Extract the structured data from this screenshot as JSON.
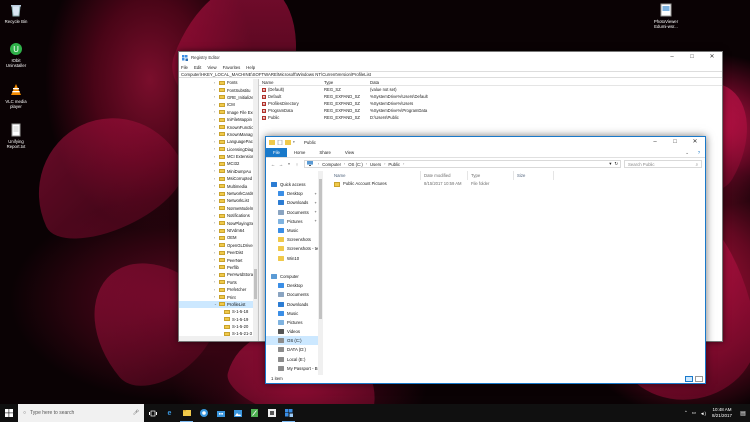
{
  "desktop_icons": [
    {
      "label": "Recycle Bin",
      "icon": "recycle-bin-icon"
    },
    {
      "label": "IObit Uninstaller",
      "icon": "iobit-uninstaller-icon"
    },
    {
      "label": "VLC media player",
      "icon": "vlc-icon"
    },
    {
      "label": "Unifying Report.txt",
      "icon": "text-file-icon"
    },
    {
      "label": "PhotoViewer Edumi-wsr...",
      "icon": "image-file-icon"
    }
  ],
  "regedit": {
    "title": "Registry Editor",
    "menu": [
      "File",
      "Edit",
      "View",
      "Favorites",
      "Help"
    ],
    "address": "Computer\\HKEY_LOCAL_MACHINE\\SOFTWARE\\Microsoft\\Windows NT\\CurrentVersion\\ProfileList",
    "tree": [
      "Fonts",
      "FontSubstitu",
      "GRE_Initialize",
      "ICM",
      "Image File Exe",
      "IniFileMappin",
      "KnownFunctio",
      "KnownManag",
      "LanguagePacl",
      "LicensingDiag",
      "MCI Extension",
      "MCI32",
      "MiniDumpAu",
      "MsiCorrupted",
      "Multimedia",
      "NetworkCards",
      "NetworkList",
      "NoImeModelm",
      "Notifications",
      "NowPlayingSe",
      "NtVdm64",
      "OEM",
      "OpenGLDriver",
      "PeerDist",
      "PeerNet",
      "Perflib",
      "PerHwIdStora",
      "Ports",
      "Prefetcher",
      "Print",
      "ProfileList"
    ],
    "subkeys": [
      "S-1-5-18",
      "S-1-5-19",
      "S-1-5-20",
      "S-1-5-21-3",
      "S-1-5-21-3"
    ],
    "tree_last": "ProfileNotifica",
    "columns": {
      "name": "Name",
      "type": "Type",
      "data": "Data"
    },
    "values": [
      {
        "name": "(Default)",
        "type": "REG_SZ",
        "data": "(value not set)"
      },
      {
        "name": "Default",
        "type": "REG_EXPAND_SZ",
        "data": "%SystemDrive%\\Users\\Default"
      },
      {
        "name": "ProfilesDirectory",
        "type": "REG_EXPAND_SZ",
        "data": "%SystemDrive%\\Users"
      },
      {
        "name": "ProgramData",
        "type": "REG_EXPAND_SZ",
        "data": "%SystemDrive%\\ProgramData"
      },
      {
        "name": "Public",
        "type": "REG_EXPAND_SZ",
        "data": "D:\\Users\\Public"
      }
    ]
  },
  "explorer": {
    "title": "Public",
    "ribbon_tabs": [
      "File",
      "Home",
      "Share",
      "View"
    ],
    "path": [
      "Computer",
      "OS (C:)",
      "Users",
      "Public"
    ],
    "search_placeholder": "Search Public",
    "nav": [
      {
        "label": "Quick access",
        "top": true,
        "color": "#2b7cd3",
        "pin": false
      },
      {
        "label": "Desktop",
        "top": false,
        "color": "#3a8ee6",
        "pin": true
      },
      {
        "label": "Downloads",
        "top": false,
        "color": "#2b7cd3",
        "pin": true
      },
      {
        "label": "Documents",
        "top": false,
        "color": "#8aa4c1",
        "pin": true
      },
      {
        "label": "Pictures",
        "top": false,
        "color": "#7fb3e0",
        "pin": true
      },
      {
        "label": "Music",
        "top": false,
        "color": "#3a8ee6",
        "pin": false
      },
      {
        "label": "Screenshots",
        "top": false,
        "color": "#f0c94a",
        "pin": false
      },
      {
        "label": "Screenshots - ten",
        "top": false,
        "color": "#f0c94a",
        "pin": false
      },
      {
        "label": "Win10",
        "top": false,
        "color": "#f0c94a",
        "pin": false
      },
      {
        "label": "",
        "top": false,
        "color": "transparent",
        "pin": false
      },
      {
        "label": "Computer",
        "top": true,
        "color": "#5b9bd5",
        "pin": false
      },
      {
        "label": "Desktop",
        "top": false,
        "color": "#3a8ee6",
        "pin": false
      },
      {
        "label": "Documents",
        "top": false,
        "color": "#8aa4c1",
        "pin": false
      },
      {
        "label": "Downloads",
        "top": false,
        "color": "#2b7cd3",
        "pin": false
      },
      {
        "label": "Music",
        "top": false,
        "color": "#3a8ee6",
        "pin": false
      },
      {
        "label": "Pictures",
        "top": false,
        "color": "#7fb3e0",
        "pin": false
      },
      {
        "label": "Videos",
        "top": false,
        "color": "#555555",
        "pin": false
      },
      {
        "label": "OS (C:)",
        "top": false,
        "color": "#8c8c8c",
        "pin": false,
        "selected": true
      },
      {
        "label": "DATA (D:)",
        "top": false,
        "color": "#8c8c8c",
        "pin": false
      },
      {
        "label": "Local (E:)",
        "top": false,
        "color": "#8c8c8c",
        "pin": false
      },
      {
        "label": "My Passport - B",
        "top": false,
        "color": "#8c8c8c",
        "pin": false
      }
    ],
    "columns": {
      "name": "Name",
      "date": "Date modified",
      "type": "Type",
      "size": "Size"
    },
    "files": [
      {
        "name": "Public Account Pictures",
        "date": "8/15/2017 10:59 AM",
        "type": "File folder",
        "size": ""
      }
    ],
    "status": "1 item"
  },
  "taskbar": {
    "search_placeholder": "Type here to search",
    "time": "10:48 AM",
    "date": "8/21/2017"
  }
}
